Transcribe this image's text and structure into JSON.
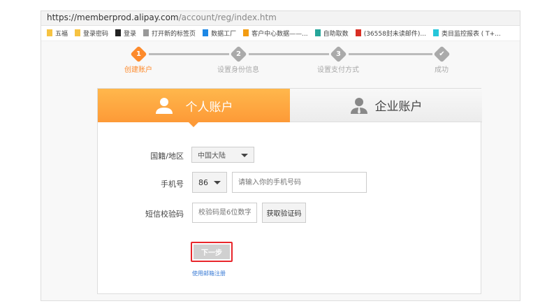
{
  "browser": {
    "url_host": "https://memberprod.alipay.com",
    "url_path": "/account/reg/index.htm",
    "bookmarks": [
      {
        "label": "五福",
        "icon": "folder-icon",
        "color": "#f6c342"
      },
      {
        "label": "登录密码",
        "icon": "folder-icon",
        "color": "#f6c342"
      },
      {
        "label": "登录",
        "icon": "bird-icon",
        "color": "#222222"
      },
      {
        "label": "打开新的标签页",
        "icon": "page-icon",
        "color": "#999999"
      },
      {
        "label": "数据工厂",
        "icon": "cloud-icon",
        "color": "#1e88e5"
      },
      {
        "label": "客户中心数据——...",
        "icon": "chart-icon",
        "color": "#f39c12"
      },
      {
        "label": "自助取数",
        "icon": "app-icon",
        "color": "#26a69a"
      },
      {
        "label": "(36558封未读邮件)...",
        "icon": "gmail-icon",
        "color": "#d93025"
      },
      {
        "label": "类目监控报表 ( T+...",
        "icon": "drop-icon",
        "color": "#26c6da"
      }
    ]
  },
  "steps": [
    {
      "num": "1",
      "label": "创建账户",
      "active": true
    },
    {
      "num": "2",
      "label": "设置身份信息",
      "active": false
    },
    {
      "num": "3",
      "label": "设置支付方式",
      "active": false
    },
    {
      "num": "✔",
      "label": "成功",
      "active": false
    }
  ],
  "colors": {
    "accent": "#fd8a2b",
    "highlight": "#e8262b",
    "link": "#3a7bd5"
  },
  "tabs": [
    {
      "label": "个人账户",
      "icon": "person-icon",
      "active": true
    },
    {
      "label": "企业账户",
      "icon": "business-person-icon",
      "active": false
    }
  ],
  "form": {
    "region_label": "国籍/地区",
    "region_value": "中国大陆",
    "phone_label": "手机号",
    "phone_code": "86",
    "phone_placeholder": "请输入你的手机号码",
    "sms_label": "短信校验码",
    "sms_placeholder": "校验码是6位数字",
    "sms_button": "获取验证码",
    "next_button": "下一步",
    "email_link": "使用邮箱注册"
  }
}
